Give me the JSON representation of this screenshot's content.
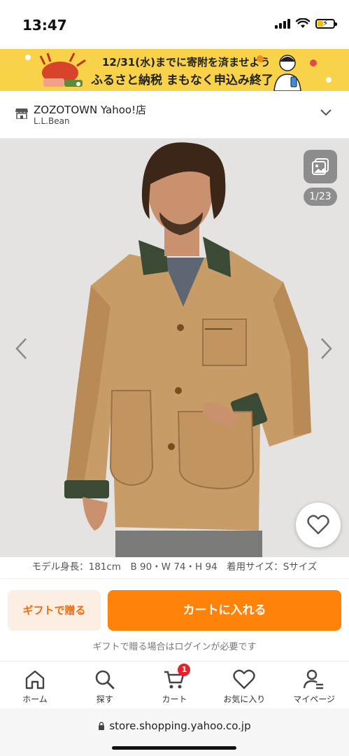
{
  "status_bar": {
    "time": "13:47",
    "battery_fraction": 0.35,
    "battery_color": "#f2c200"
  },
  "banner": {
    "line1": "12/31(水)までに寄附を済ませよう",
    "line2": "ふるさと納税 まもなく申込み終了",
    "background": "#f8d34a"
  },
  "store": {
    "name": "ZOZOTOWN Yahoo!店",
    "brand": "L.L.Bean",
    "icon": "store-icon",
    "toggle_icon": "chevron-down-icon"
  },
  "gallery": {
    "counter": "1/23",
    "current_index": 1,
    "total": 23,
    "gallery_icon": "image-gallery-icon",
    "prev_icon": "chevron-left-icon",
    "next_icon": "chevron-right-icon",
    "favorite_icon": "heart-icon"
  },
  "model_info": "モデル身長：181cm　B 90・W 74・H 94　着用サイズ：Sサイズ",
  "actions": {
    "gift_label": "ギフトで贈る",
    "cart_label": "カートに入れる",
    "gift_note": "ギフトで贈る場合はログインが必要です",
    "accent_color": "#ff820a"
  },
  "tab_bar": {
    "items": [
      {
        "label": "ホーム",
        "icon": "home-icon"
      },
      {
        "label": "探す",
        "icon": "search-icon"
      },
      {
        "label": "カート",
        "icon": "cart-icon",
        "badge": "1"
      },
      {
        "label": "お気に入り",
        "icon": "heart-icon"
      },
      {
        "label": "マイページ",
        "icon": "user-icon"
      }
    ]
  },
  "address_bar": {
    "url": "store.shopping.yahoo.co.jp",
    "icon": "lock-icon"
  }
}
